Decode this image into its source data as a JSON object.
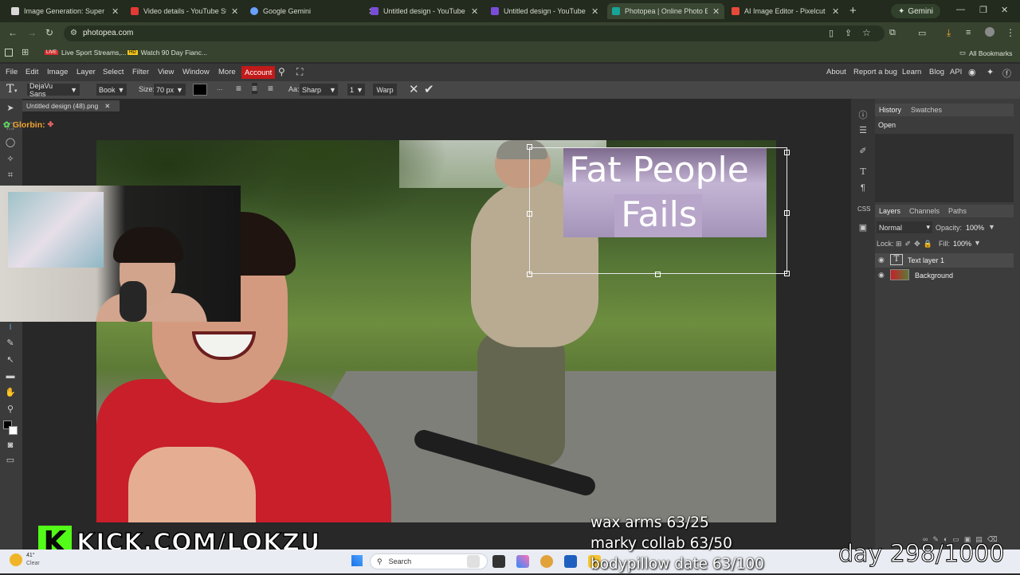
{
  "browser": {
    "tabs": [
      {
        "label": "Image Generation: Super Fat",
        "color": "#d8d8d8"
      },
      {
        "label": "Video details - YouTube Studi",
        "color": "#e53935"
      },
      {
        "label": "Google Gemini",
        "color": "#6aa0ff"
      },
      {
        "label": "Untitled design - YouTube Th",
        "color": "#7a4dd8"
      },
      {
        "label": "Untitled design - YouTube Th",
        "color": "#7a4dd8"
      },
      {
        "label": "Photopea | Online Photo Edit",
        "color": "#18a497"
      },
      {
        "label": "AI Image Editor - Pixelcut",
        "color": "#e84a3a"
      }
    ],
    "gemini_button": "Gemini",
    "url": "photopea.com",
    "bookmarks": [
      "Live Sport Streams,...",
      "Watch 90 Day Fianc..."
    ],
    "all_bookmarks": "All Bookmarks"
  },
  "photopea": {
    "menu": [
      "File",
      "Edit",
      "Image",
      "Layer",
      "Select",
      "Filter",
      "View",
      "Window",
      "More"
    ],
    "account": "Account",
    "right_menu": [
      "About",
      "Report a bug",
      "Learn",
      "Blog",
      "API"
    ],
    "options": {
      "font": "DejaVu Sans",
      "weight": "Book",
      "size_label": "Size:",
      "size_value": "70 px",
      "aa_label": "Aa:",
      "aa_value": "Sharp",
      "line_value": "1",
      "warp": "Warp"
    },
    "doc_tab": "Untitled design (48).png",
    "panels": {
      "history_tabs": [
        "History",
        "Swatches"
      ],
      "history_items": [
        "Open"
      ],
      "layer_tabs": [
        "Layers",
        "Channels",
        "Paths"
      ],
      "blend_mode": "Normal",
      "opacity_label": "Opacity:",
      "opacity_value": "100%",
      "lock_label": "Lock:",
      "fill_label": "Fill:",
      "fill_value": "100%",
      "layers": [
        "Text layer 1",
        "Background"
      ]
    },
    "canvas_text": {
      "line1": "Fat People",
      "line2": "Fails"
    }
  },
  "overlay": {
    "chat_name": "Glorbin:",
    "kick_url": "KICK.COM/LOKZU",
    "goals": [
      "wax arms 63/25",
      "marky collab 63/50",
      "bodypillow date 63/100"
    ],
    "day_counter": "day 298/1000"
  },
  "taskbar": {
    "search": "Search",
    "weather_temp": "41°",
    "weather_label": "Clear"
  }
}
